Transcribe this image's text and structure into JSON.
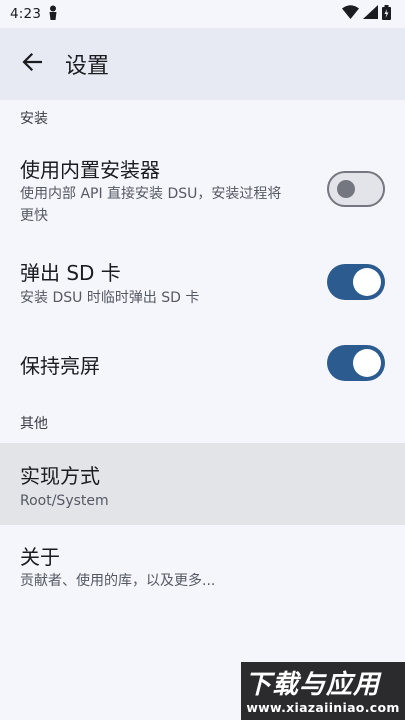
{
  "status_bar": {
    "time": "4:23",
    "left_icons": [
      "person-icon"
    ],
    "right_icons": [
      "wifi-icon",
      "signal-icon",
      "battery-icon"
    ]
  },
  "app_bar": {
    "title": "设置",
    "back_icon": "arrow-back-icon"
  },
  "sections": [
    {
      "header": "安装",
      "items": [
        {
          "title": "使用内置安装器",
          "summary_lines": [
            "使用内部 API 直接安装 DSU，安装过程将",
            "更快"
          ],
          "toggle": "off"
        },
        {
          "title": "弹出 SD 卡",
          "summary_lines": [
            "安装 DSU 时临时弹出 SD 卡"
          ],
          "toggle": "on"
        },
        {
          "title": "保持亮屏",
          "toggle": "on"
        }
      ]
    },
    {
      "header": "其他",
      "items": [
        {
          "title": "实现方式",
          "summary_lines": [
            "Root/System"
          ],
          "highlighted": true
        },
        {
          "title": "关于",
          "summary_lines": [
            "贡献者、使用的库，以及更多..."
          ]
        }
      ]
    }
  ],
  "watermark": {
    "main": "下载与应用",
    "sub": "www.xiazaiiniao.com"
  },
  "colors": {
    "background": "#f5f6fb",
    "app_bar": "#e7eaf2",
    "toggle_on": "#2c5c8f",
    "toggle_off_outline": "#74777f",
    "highlight": "#e3e4e8"
  }
}
